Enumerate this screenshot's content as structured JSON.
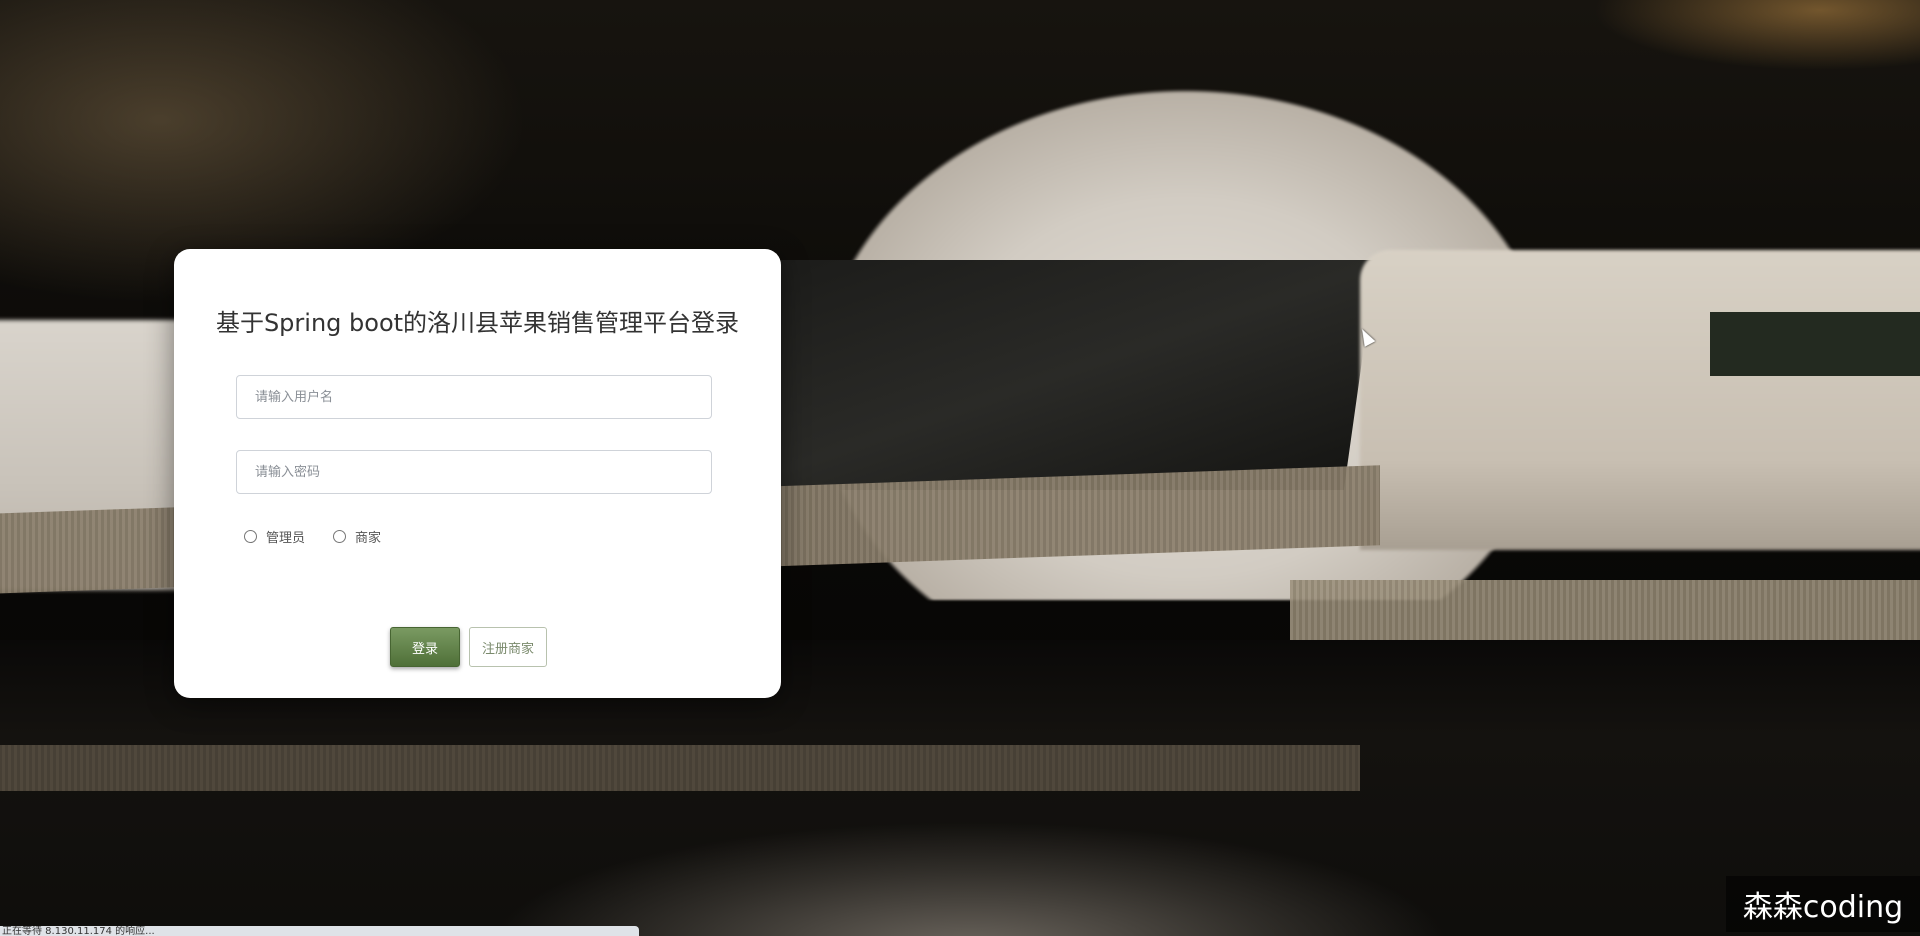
{
  "login": {
    "title": "基于Spring boot的洛川县苹果销售管理平台登录",
    "username_placeholder": "请输入用户名",
    "password_placeholder": "请输入密码",
    "roles": [
      "管理员",
      "商家"
    ],
    "login_button": "登录",
    "register_button": "注册商家"
  },
  "status_bar": {
    "text": "正在等待 8.130.11.174 的响应..."
  },
  "watermark": "森森coding",
  "colors": {
    "primary_button": "#5e7f45",
    "card_bg": "#ffffff"
  }
}
